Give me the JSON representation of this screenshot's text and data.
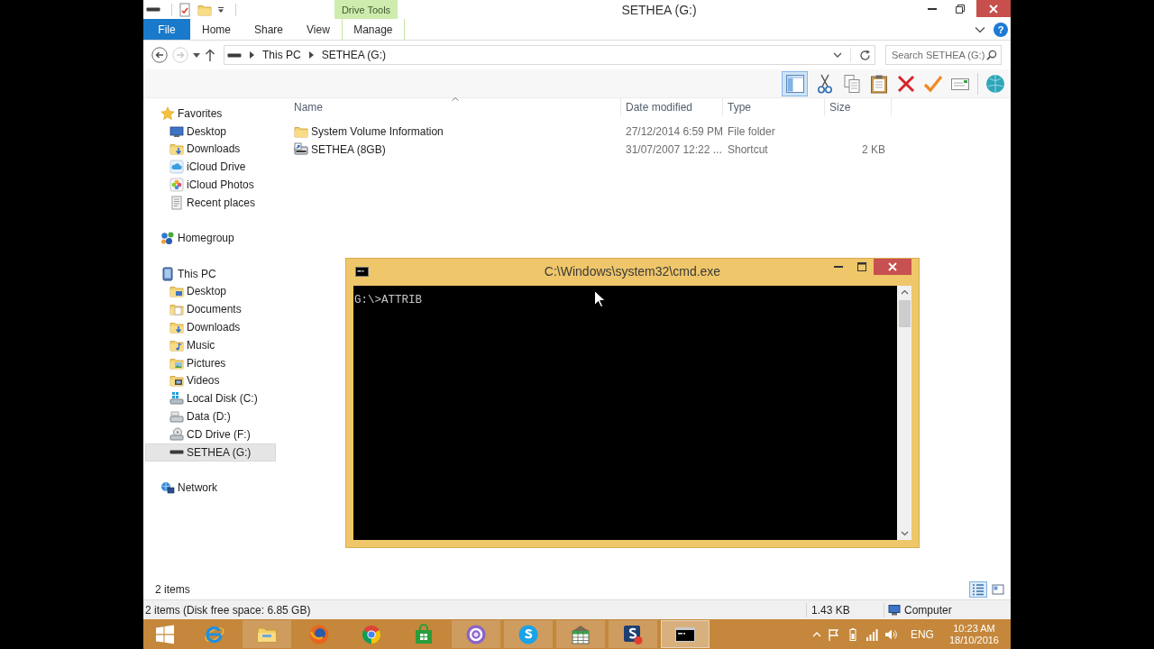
{
  "explorer": {
    "title": "SETHEA (G:)",
    "context_group": "Drive Tools",
    "ribbon_tabs": [
      {
        "label": "File",
        "kind": "file"
      },
      {
        "label": "Home",
        "kind": "plain"
      },
      {
        "label": "Share",
        "kind": "plain"
      },
      {
        "label": "View",
        "kind": "plain"
      },
      {
        "label": "Manage",
        "kind": "contextual"
      }
    ],
    "help": "?",
    "navigation": {
      "back": {
        "disabled": false
      },
      "forward": {
        "disabled": true
      }
    },
    "address": {
      "crumbs": [
        "This PC",
        "SETHEA (G:)"
      ]
    },
    "search": {
      "placeholder": "Search SETHEA (G:)"
    },
    "toolbar": {
      "preview_pane": {
        "on": true
      }
    },
    "sidebar": [
      {
        "label": "Favorites",
        "kind": "star",
        "selected": false,
        "children": [
          {
            "label": "Desktop",
            "kind": "monitor",
            "selected": false
          },
          {
            "label": "Downloads",
            "kind": "downloads",
            "selected": false
          },
          {
            "label": "iCloud Drive",
            "kind": "cloud",
            "selected": false
          },
          {
            "label": "iCloud Photos",
            "kind": "photos",
            "selected": false
          },
          {
            "label": "Recent places",
            "kind": "recent",
            "selected": false
          }
        ]
      },
      {
        "label": "Homegroup",
        "kind": "homegroup",
        "selected": false
      },
      {
        "label": "This PC",
        "kind": "pc",
        "selected": false,
        "children": [
          {
            "label": "Desktop",
            "kind": "deskfolder",
            "selected": false
          },
          {
            "label": "Documents",
            "kind": "documents",
            "selected": false
          },
          {
            "label": "Downloads",
            "kind": "downloads",
            "selected": false
          },
          {
            "label": "Music",
            "kind": "music",
            "selected": false
          },
          {
            "label": "Pictures",
            "kind": "pictures",
            "selected": false
          },
          {
            "label": "Videos",
            "kind": "videos",
            "selected": false
          },
          {
            "label": "Local Disk (C:)",
            "kind": "sysdisk",
            "selected": false
          },
          {
            "label": "Data (D:)",
            "kind": "disk",
            "selected": false
          },
          {
            "label": "CD Drive (F:)",
            "kind": "cd",
            "selected": false
          },
          {
            "label": "SETHEA (G:)",
            "kind": "usb",
            "selected": true
          }
        ]
      },
      {
        "label": "Network",
        "kind": "network",
        "selected": false
      }
    ],
    "columns": [
      {
        "label": "Name",
        "sorted": true
      },
      {
        "label": "Date modified",
        "sorted": false
      },
      {
        "label": "Type",
        "sorted": false
      },
      {
        "label": "Size",
        "sorted": false
      }
    ],
    "rows": [
      {
        "kind": "folder",
        "name": "System Volume Information",
        "date": "27/12/2014 6:59 PM",
        "type": "File folder"
      },
      {
        "kind": "shortcut",
        "name": "SETHEA (8GB)",
        "date": "31/07/2007 12:22 ...",
        "type": "Shortcut",
        "size": "2 KB"
      }
    ],
    "item_count": "2 items",
    "view_buttons": [
      {
        "kind": "details",
        "selected": true
      },
      {
        "kind": "tiles",
        "selected": false
      }
    ]
  },
  "status_bar": {
    "summary": "2 items (Disk free space: 6.85 GB)",
    "size": "1.43 KB",
    "location": "Computer"
  },
  "console": {
    "title": "C:\\Windows\\system32\\cmd.exe",
    "lines": [
      "G:\\>ATTRIB"
    ]
  },
  "taskbar": {
    "apps": [
      {
        "kind": "ie",
        "running": false,
        "focused": false
      },
      {
        "kind": "explorer",
        "running": true,
        "focused": false
      },
      {
        "kind": "firefox",
        "running": false,
        "focused": false
      },
      {
        "kind": "chrome",
        "running": false,
        "focused": false
      },
      {
        "kind": "store",
        "running": false,
        "focused": false
      },
      {
        "kind": "ring",
        "running": true,
        "focused": false
      },
      {
        "kind": "skype",
        "running": true,
        "focused": false
      },
      {
        "kind": "sheet",
        "running": true,
        "focused": false
      },
      {
        "kind": "sapp",
        "running": true,
        "focused": false
      },
      {
        "kind": "terminal",
        "running": true,
        "focused": true
      }
    ],
    "tray": {
      "language": "ENG",
      "time": "10:23 AM",
      "date": "18/10/2016"
    }
  }
}
